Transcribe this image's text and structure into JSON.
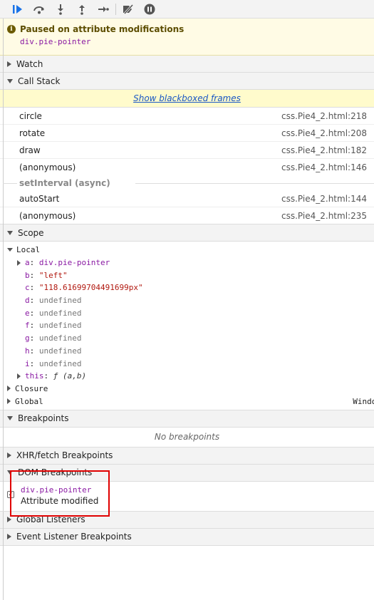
{
  "toolbar": {
    "buttons": [
      "resume-icon",
      "step-over-icon",
      "step-into-icon",
      "step-out-icon",
      "step-icon",
      "deactivate-breakpoints-icon",
      "pause-on-exceptions-icon"
    ]
  },
  "paused": {
    "title": "Paused on attribute modifications",
    "target": "div.pie-pointer"
  },
  "sections": {
    "watch": "Watch",
    "call_stack": "Call Stack",
    "scope": "Scope",
    "breakpoints": "Breakpoints",
    "xhr": "XHR/fetch Breakpoints",
    "dom": "DOM Breakpoints",
    "global_listeners": "Global Listeners",
    "event_listeners": "Event Listener Breakpoints"
  },
  "call_stack": {
    "blackboxed_link": "Show blackboxed frames",
    "frames": [
      {
        "name": "circle",
        "location": "css.Pie4_2.html:218"
      },
      {
        "name": "rotate",
        "location": "css.Pie4_2.html:208"
      },
      {
        "name": "draw",
        "location": "css.Pie4_2.html:182"
      },
      {
        "name": "(anonymous)",
        "location": "css.Pie4_2.html:146"
      }
    ],
    "async_label": "setInterval (async)",
    "async_frames": [
      {
        "name": "autoStart",
        "location": "css.Pie4_2.html:144"
      },
      {
        "name": "(anonymous)",
        "location": "css.Pie4_2.html:235"
      }
    ]
  },
  "scope": {
    "local_label": "Local",
    "vars": [
      {
        "key": "a",
        "value": "div.pie-pointer"
      },
      {
        "key": "b",
        "value": "\"left\""
      },
      {
        "key": "c",
        "value": "\"118.61699704491699px\""
      },
      {
        "key": "d",
        "value": "undefined"
      },
      {
        "key": "e",
        "value": "undefined"
      },
      {
        "key": "f",
        "value": "undefined"
      },
      {
        "key": "g",
        "value": "undefined"
      },
      {
        "key": "h",
        "value": "undefined"
      },
      {
        "key": "i",
        "value": "undefined"
      }
    ],
    "this_key": "this",
    "this_f": "ƒ",
    "this_sig": "(a,b)",
    "closure_label": "Closure",
    "global_label": "Global",
    "global_value": "Window"
  },
  "breakpoints": {
    "empty_text": "No breakpoints"
  },
  "dom_breakpoint": {
    "target": "div.pie-pointer",
    "type": "Attribute modified"
  },
  "colors": {
    "highlight_box": "#e00000",
    "paused_bg": "#fffbe5",
    "blackbox_bg": "#fffbcc",
    "link": "#1a57c4",
    "resume_blue": "#1a73e8"
  }
}
